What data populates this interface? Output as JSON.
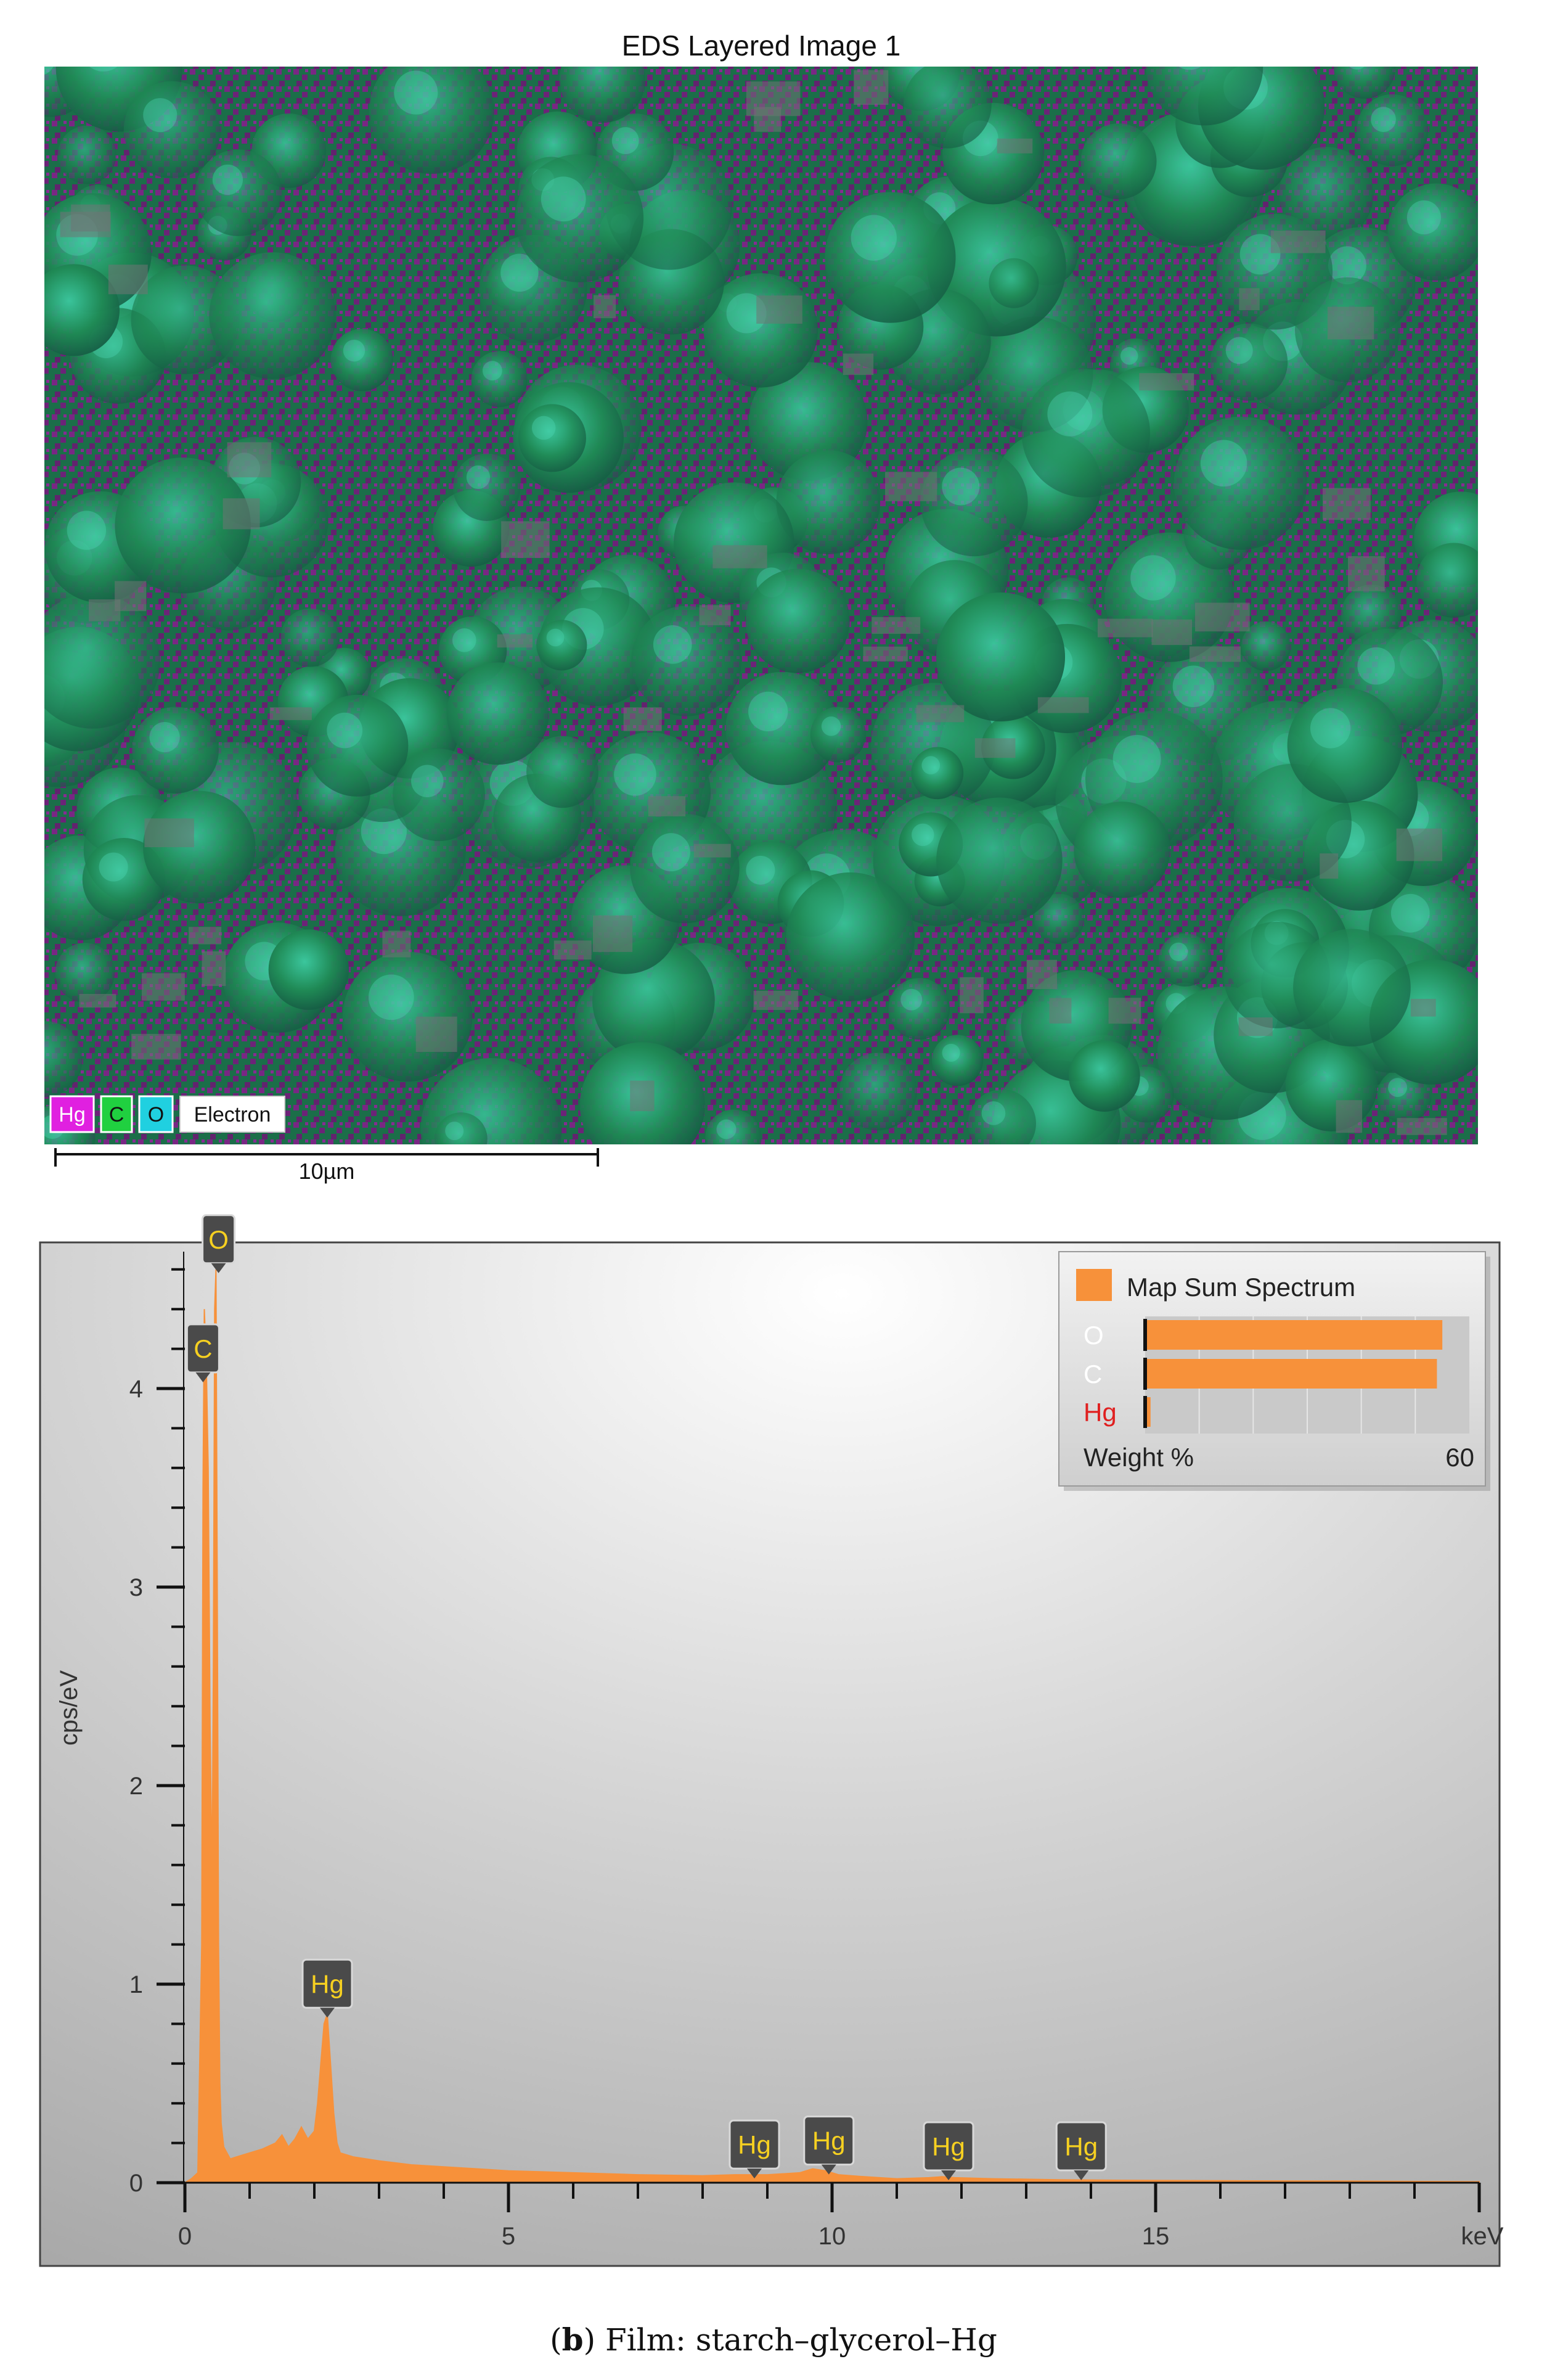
{
  "eds_map": {
    "title": "EDS Layered Image 1",
    "layers": [
      {
        "label": "Hg",
        "color": "#e020e0"
      },
      {
        "label": "C",
        "color": "#20d040"
      },
      {
        "label": "O",
        "color": "#20d0e0"
      },
      {
        "label": "Electron",
        "color": "#ffffff"
      }
    ],
    "scale_bar_label": "10µm",
    "colors": {
      "hg": "#8a1a8e",
      "c_green": "#1f8a55",
      "o_cyan": "#30c0c0",
      "electron_gray": "#6f7474"
    }
  },
  "chart_data": {
    "type": "area",
    "xlabel": "keV",
    "ylabel": "cps/eV",
    "xlim": [
      0,
      20
    ],
    "ylim": [
      0,
      4.8
    ],
    "x_ticks": [
      0,
      5,
      10,
      15
    ],
    "y_ticks": [
      0,
      1,
      2,
      3,
      4
    ],
    "series": [
      {
        "name": "Map Sum Spectrum",
        "color": "#f7913a",
        "x": [
          0,
          0.1,
          0.2,
          0.26,
          0.28,
          0.3,
          0.33,
          0.36,
          0.39,
          0.42,
          0.44,
          0.46,
          0.48,
          0.5,
          0.52,
          0.54,
          0.56,
          0.6,
          0.7,
          0.8,
          1.0,
          1.2,
          1.4,
          1.5,
          1.6,
          1.7,
          1.8,
          1.9,
          2.0,
          2.05,
          2.1,
          2.15,
          2.2,
          2.25,
          2.3,
          2.35,
          2.4,
          2.6,
          3.0,
          3.5,
          4.0,
          5.0,
          6.0,
          7.0,
          8.0,
          8.5,
          9.0,
          9.5,
          9.7,
          9.9,
          10.1,
          10.5,
          11.0,
          11.5,
          11.7,
          11.9,
          12.5,
          13.5,
          14.5,
          16,
          18,
          20
        ],
        "y": [
          0,
          0.02,
          0.05,
          1.2,
          3.5,
          4.4,
          4.15,
          3.6,
          2.3,
          1.5,
          2.6,
          4.4,
          4.6,
          3.0,
          1.2,
          0.5,
          0.3,
          0.18,
          0.12,
          0.13,
          0.15,
          0.17,
          0.2,
          0.24,
          0.18,
          0.22,
          0.28,
          0.22,
          0.26,
          0.4,
          0.6,
          0.8,
          0.85,
          0.6,
          0.35,
          0.2,
          0.15,
          0.13,
          0.11,
          0.09,
          0.08,
          0.06,
          0.05,
          0.04,
          0.035,
          0.04,
          0.04,
          0.05,
          0.07,
          0.06,
          0.04,
          0.03,
          0.02,
          0.025,
          0.03,
          0.025,
          0.02,
          0.015,
          0.012,
          0.01,
          0.008,
          0.005
        ]
      }
    ],
    "peak_labels": [
      {
        "label": "O",
        "x": 0.52,
        "y": 4.6
      },
      {
        "label": "C",
        "x": 0.28,
        "y": 4.05
      },
      {
        "label": "Hg",
        "x": 2.2,
        "y": 0.85
      },
      {
        "label": "Hg",
        "x": 8.8,
        "y": 0.04
      },
      {
        "label": "Hg",
        "x": 9.95,
        "y": 0.06
      },
      {
        "label": "Hg",
        "x": 11.8,
        "y": 0.03
      },
      {
        "label": "Hg",
        "x": 13.85,
        "y": 0.02
      }
    ],
    "legend": {
      "title": "Map Sum Spectrum",
      "placement": "top-right",
      "axis_label": "Weight %",
      "axis_max": 60,
      "entries": [
        {
          "element": "O",
          "weight_percent": 55,
          "color": "#ffffff"
        },
        {
          "element": "C",
          "weight_percent": 54,
          "color": "#ffffff"
        },
        {
          "element": "Hg",
          "weight_percent": 1,
          "color": "#e02020"
        }
      ]
    }
  },
  "caption": {
    "bold": "b",
    "text": "Film: starch–glycerol–Hg"
  }
}
